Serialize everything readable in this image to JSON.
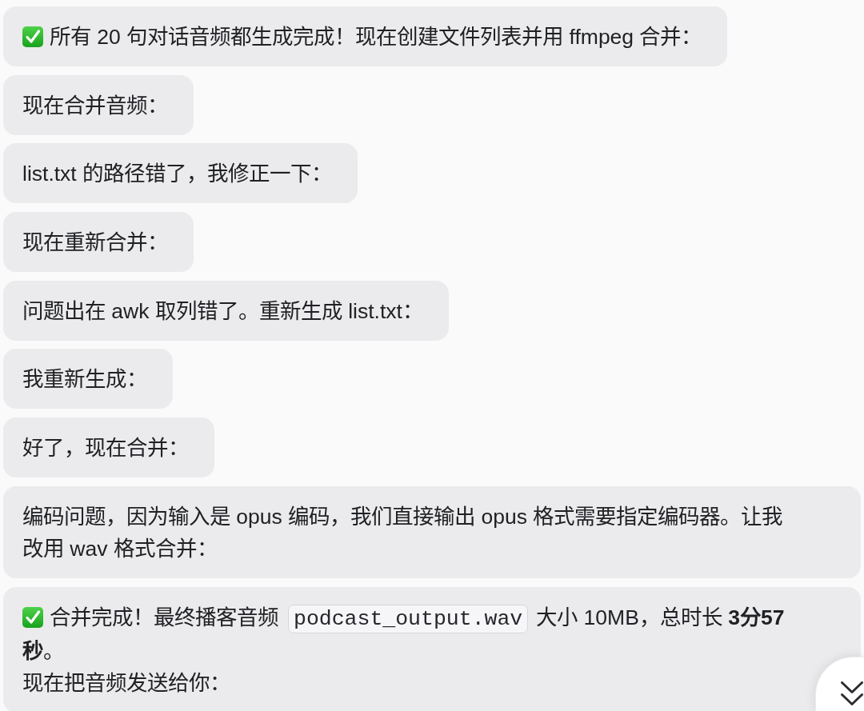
{
  "messages": [
    {
      "kind": "done",
      "paragraphs": [
        [
          {
            "kind": "text",
            "text": "所有 20 句对话音频都生成完成！现在创建文件列表并用 ffmpeg 合并："
          }
        ]
      ]
    },
    {
      "kind": "plain",
      "paragraphs": [
        [
          {
            "kind": "text",
            "text": "现在合并音频："
          }
        ]
      ]
    },
    {
      "kind": "plain",
      "paragraphs": [
        [
          {
            "kind": "text",
            "text": "list.txt 的路径错了，我修正一下："
          }
        ]
      ]
    },
    {
      "kind": "plain",
      "paragraphs": [
        [
          {
            "kind": "text",
            "text": "现在重新合并："
          }
        ]
      ]
    },
    {
      "kind": "plain",
      "paragraphs": [
        [
          {
            "kind": "text",
            "text": "问题出在 awk 取列错了。重新生成 list.txt："
          }
        ]
      ]
    },
    {
      "kind": "plain",
      "paragraphs": [
        [
          {
            "kind": "text",
            "text": "我重新生成："
          }
        ]
      ]
    },
    {
      "kind": "plain",
      "paragraphs": [
        [
          {
            "kind": "text",
            "text": "好了，现在合并："
          }
        ]
      ]
    },
    {
      "kind": "plain",
      "paragraphs": [
        [
          {
            "kind": "text",
            "text": "编码问题，因为输入是 opus 编码，我们直接输出 opus 格式需要指定编码器。让我改用 wav 格式合并："
          }
        ]
      ]
    },
    {
      "kind": "done",
      "paragraphs": [
        [
          {
            "kind": "text",
            "text": "合并完成！最终播客音频"
          },
          {
            "kind": "code",
            "text": "podcast_output.wav"
          },
          {
            "kind": "text",
            "text": "大小 10MB，总时长 **3分57秒**。"
          }
        ],
        [
          {
            "kind": "text",
            "text": "现在把音频发送给你："
          }
        ]
      ]
    }
  ]
}
